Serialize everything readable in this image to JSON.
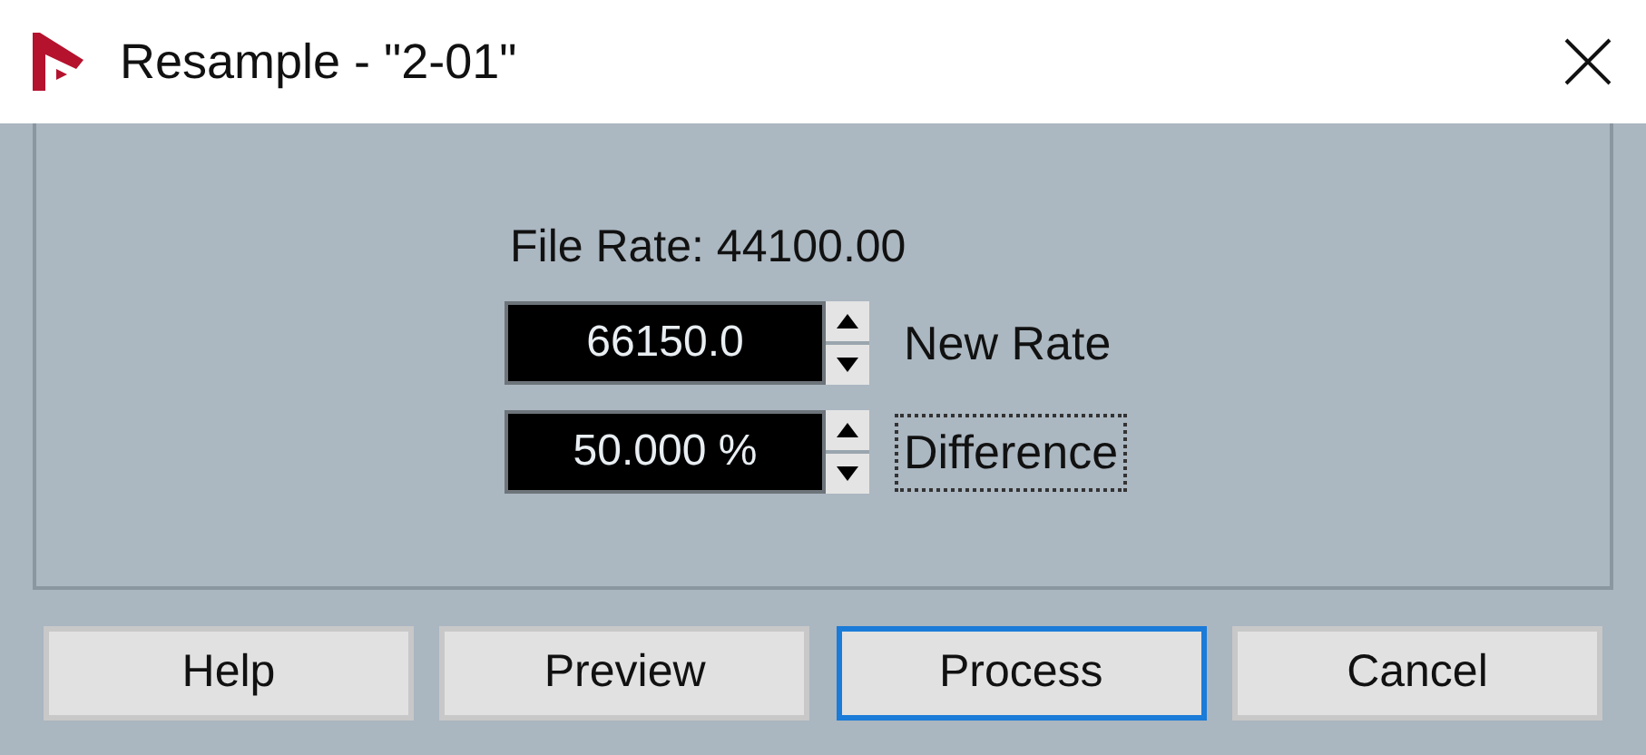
{
  "window": {
    "title": "Resample - \"2-01\""
  },
  "file_rate": "File Rate: 44100.00",
  "fields": [
    {
      "value": "66150.0",
      "label": "New Rate",
      "focused": false
    },
    {
      "value": "50.000 %",
      "label": "Difference",
      "focused": true
    }
  ],
  "buttons": [
    {
      "label": "Help",
      "focused": false
    },
    {
      "label": "Preview",
      "focused": false
    },
    {
      "label": "Process",
      "focused": true
    },
    {
      "label": "Cancel",
      "focused": false
    }
  ]
}
